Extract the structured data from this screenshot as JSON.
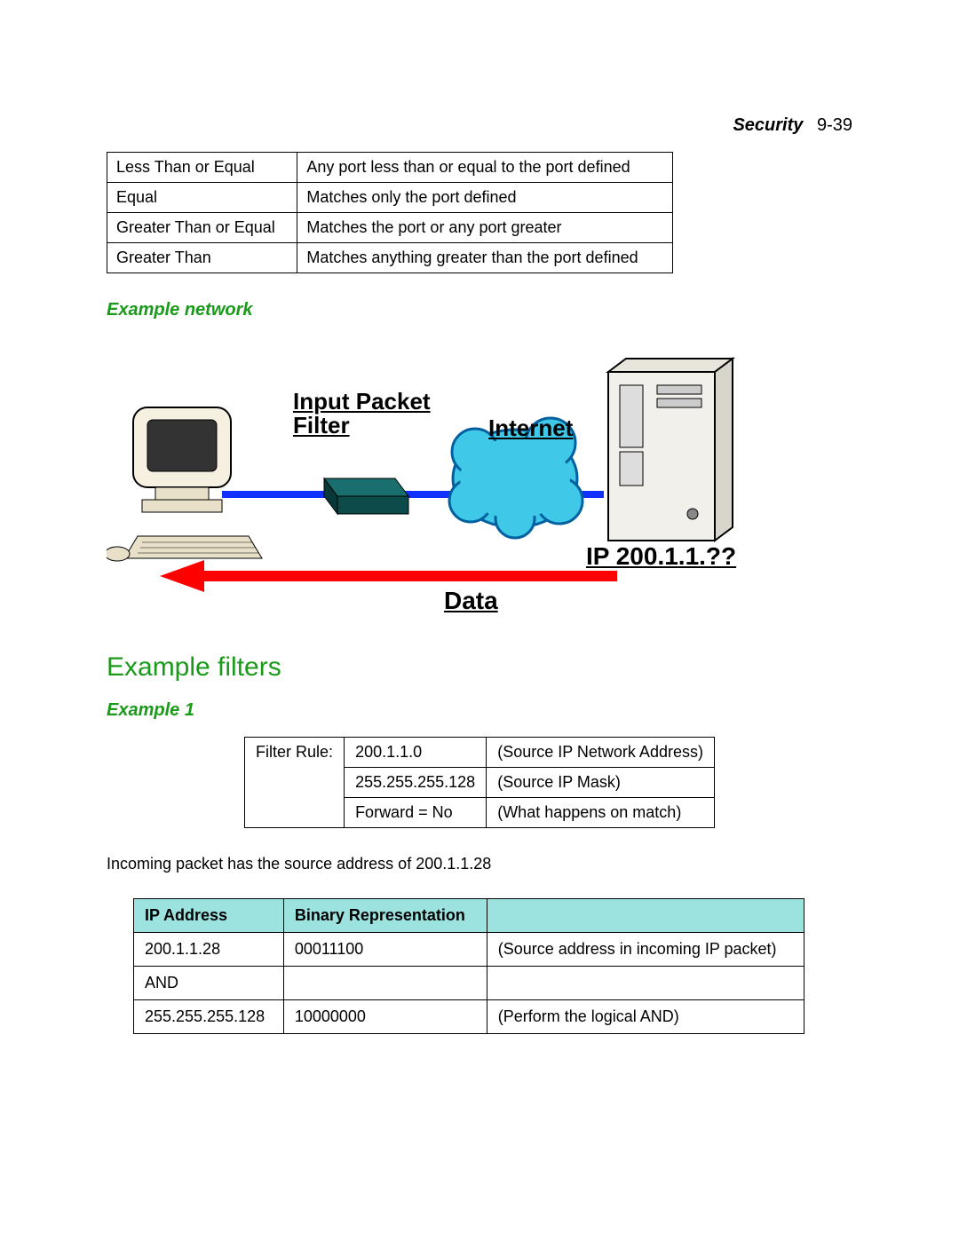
{
  "header": {
    "section": "Security",
    "page": "9-39"
  },
  "port_table": [
    {
      "op": "Less Than or Equal",
      "desc": "Any port less than or equal to the port defined"
    },
    {
      "op": "Equal",
      "desc": "Matches only the port defined"
    },
    {
      "op": "Greater Than or Equal",
      "desc": "Matches the port or any port greater"
    },
    {
      "op": "Greater Than",
      "desc": "Matches anything greater than the port defined"
    }
  ],
  "subheading_example_network": "Example network",
  "diagram": {
    "input_packet_filter": "Input Packet\nFilter",
    "internet": "Internet",
    "ip": "IP 200.1.1.??",
    "data": "Data"
  },
  "heading_example_filters": "Example filters",
  "subheading_example1": "Example 1",
  "filter_rule": {
    "label": "Filter Rule:",
    "rows": [
      {
        "val": "200.1.1.0",
        "note": "(Source IP Network Address)"
      },
      {
        "val": "255.255.255.128",
        "note": "(Source IP Mask)"
      },
      {
        "val": "Forward = No",
        "note": "(What happens on match)"
      }
    ]
  },
  "incoming_text": "Incoming packet has the source address of 200.1.1.28",
  "binary_table": {
    "headers": {
      "ip": "IP Address",
      "bin": "Binary Representation",
      "note": ""
    },
    "rows": [
      {
        "ip": "200.1.1.28",
        "bin": "00011100",
        "note": "(Source address in incoming IP packet)"
      },
      {
        "ip": "AND",
        "bin": "",
        "note": ""
      },
      {
        "ip": "255.255.255.128",
        "bin": "10000000",
        "note": "(Perform the logical AND)"
      }
    ]
  }
}
